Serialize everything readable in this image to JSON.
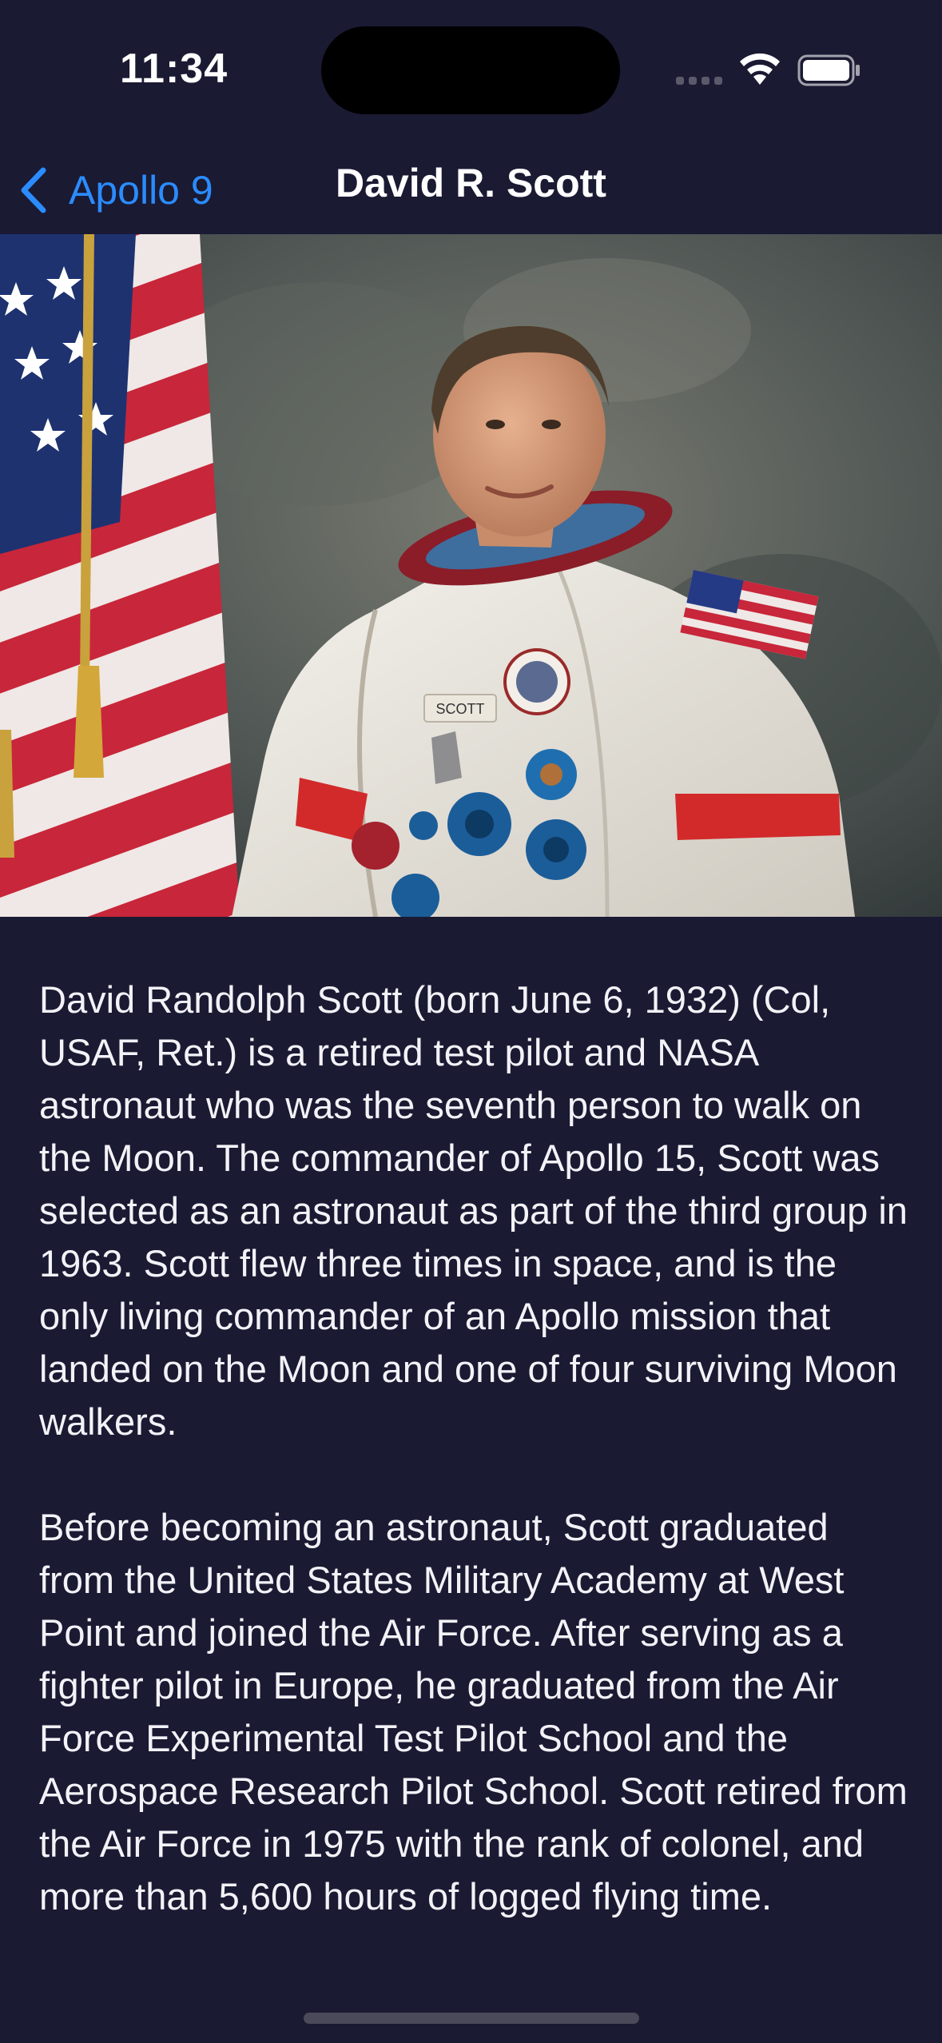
{
  "status_bar": {
    "time": "11:34"
  },
  "nav": {
    "back_label": "Apollo 9",
    "title": "David R. Scott"
  },
  "portrait": {
    "badge_text": "SCOTT"
  },
  "bio": {
    "paragraphs": [
      "David Randolph Scott (born June 6, 1932) (Col, USAF, Ret.) is a retired test pilot and NASA astronaut who was the seventh person to walk on the Moon. The commander of Apollo 15, Scott was selected as an astronaut as part of the third group in 1963. Scott flew three times in space, and is the only living commander of an Apollo mission that landed on the Moon and one of four surviving Moon walkers.",
      "Before becoming an astronaut, Scott graduated from the United States Military Academy at West Point and joined the Air Force. After serving as a fighter pilot in Europe, he graduated from the Air Force Experimental Test Pilot School and the Aerospace Research Pilot School. Scott retired from the Air Force in 1975 with the rank of colonel, and more than 5,600 hours of logged flying time."
    ]
  },
  "colors": {
    "background": "#1a1a33",
    "accent": "#2b8cff",
    "text": "#f2f2f7"
  },
  "icons": {
    "back": "chevron-left-icon",
    "wifi": "wifi-icon",
    "battery": "battery-icon",
    "signal": "cellular-signal-icon"
  }
}
